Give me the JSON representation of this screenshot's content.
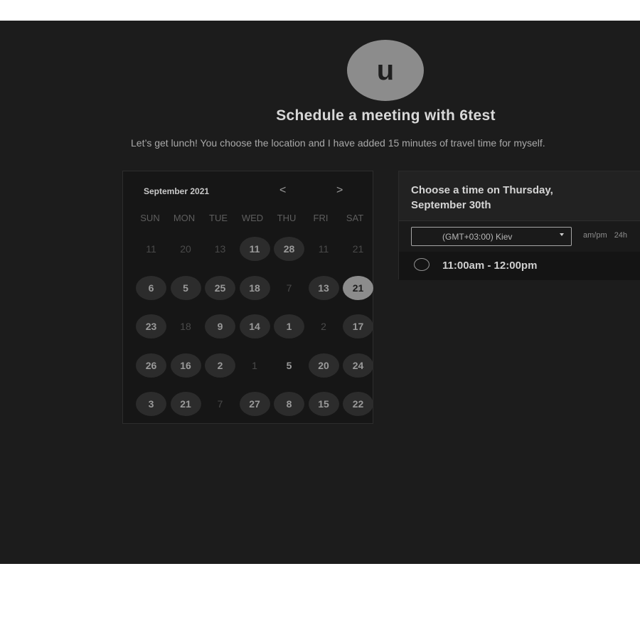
{
  "header": {
    "avatar_letter": "u",
    "title": "Schedule a meeting with 6test",
    "description": "Let’s get lunch! You choose the location and I have added 15 minutes of travel time for myself."
  },
  "calendar": {
    "month_label": "September 2021",
    "prev_icon": "<",
    "next_icon": ">",
    "weekdays": [
      "SUN",
      "MON",
      "TUE",
      "WED",
      "THU",
      "FRI",
      "SAT"
    ],
    "rows": [
      [
        {
          "label": "11",
          "state": "faded"
        },
        {
          "label": "20",
          "state": "faded"
        },
        {
          "label": "13",
          "state": "faded"
        },
        {
          "label": "11",
          "state": "available"
        },
        {
          "label": "28",
          "state": "available"
        },
        {
          "label": "11",
          "state": "faded"
        },
        {
          "label": "21",
          "state": "faded"
        }
      ],
      [
        {
          "label": "6",
          "state": "available"
        },
        {
          "label": "5",
          "state": "available"
        },
        {
          "label": "25",
          "state": "available"
        },
        {
          "label": "18",
          "state": "available"
        },
        {
          "label": "7",
          "state": "faded"
        },
        {
          "label": "13",
          "state": "available"
        },
        {
          "label": "21",
          "state": "selected"
        }
      ],
      [
        {
          "label": "23",
          "state": "available"
        },
        {
          "label": "18",
          "state": "faded"
        },
        {
          "label": "9",
          "state": "available"
        },
        {
          "label": "14",
          "state": "available"
        },
        {
          "label": "1",
          "state": "available"
        },
        {
          "label": "2",
          "state": "faded"
        },
        {
          "label": "17",
          "state": "available"
        }
      ],
      [
        {
          "label": "26",
          "state": "available"
        },
        {
          "label": "16",
          "state": "available"
        },
        {
          "label": "2",
          "state": "available"
        },
        {
          "label": "1",
          "state": "faded"
        },
        {
          "label": "5",
          "state": "plain"
        },
        {
          "label": "20",
          "state": "available"
        },
        {
          "label": "24",
          "state": "available"
        }
      ],
      [
        {
          "label": "3",
          "state": "available"
        },
        {
          "label": "21",
          "state": "available"
        },
        {
          "label": "7",
          "state": "faded"
        },
        {
          "label": "27",
          "state": "available"
        },
        {
          "label": "8",
          "state": "available"
        },
        {
          "label": "15",
          "state": "available"
        },
        {
          "label": "22",
          "state": "available"
        }
      ]
    ]
  },
  "time_panel": {
    "heading": "Choose a time on Thursday, September 30th",
    "timezone_value": "(GMT+03:00) Kiev",
    "format_ampm": "am/pm",
    "format_24h": "24h",
    "slot_label": "11:00am - 12:00pm"
  }
}
